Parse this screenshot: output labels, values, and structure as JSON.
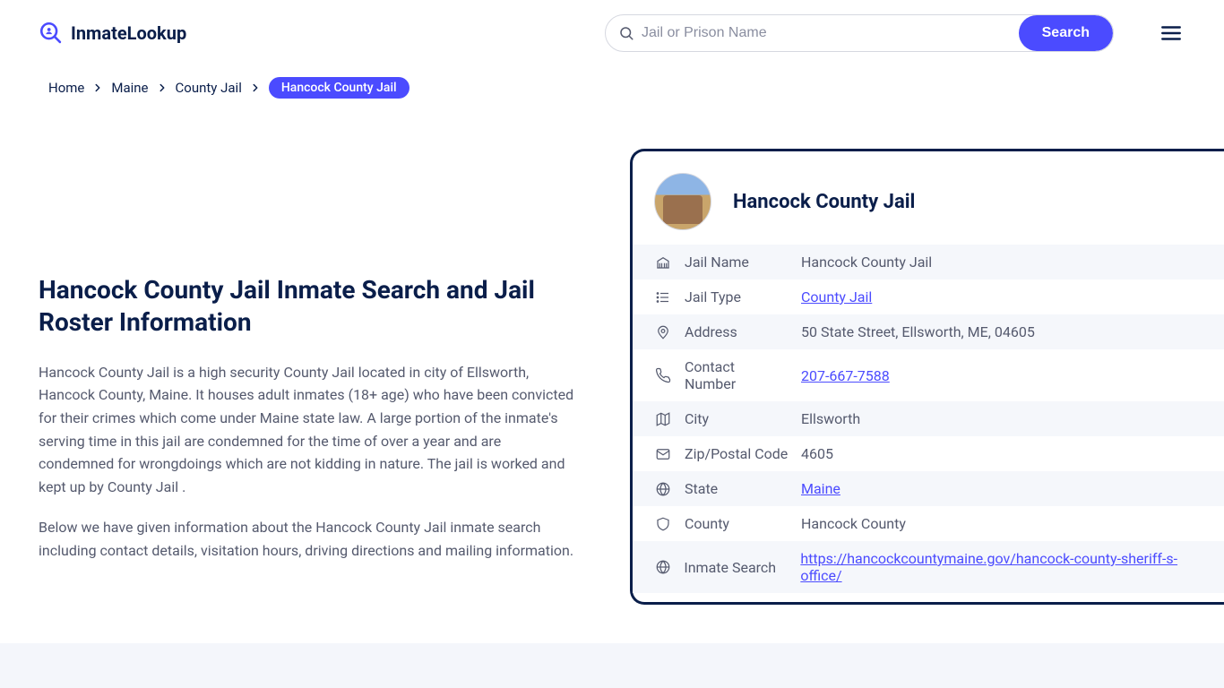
{
  "brand": {
    "name": "InmateLookup"
  },
  "search": {
    "placeholder": "Jail or Prison Name",
    "button": "Search"
  },
  "breadcrumbs": {
    "items": [
      {
        "label": "Home"
      },
      {
        "label": "Maine"
      },
      {
        "label": "County Jail"
      }
    ],
    "current": "Hancock County Jail"
  },
  "article": {
    "title": "Hancock County Jail Inmate Search and Jail Roster Information",
    "p1": "Hancock County Jail is a high security County Jail located in city of Ellsworth, Hancock County, Maine. It houses adult inmates (18+ age) who have been convicted for their crimes which come under Maine state law. A large portion of the inmate's serving time in this jail are condemned for the time of over a year and are condemned for wrongdoings which are not kidding in nature. The jail is worked and kept up by County Jail .",
    "p2": "Below we have given information about the Hancock County Jail inmate search including contact details, visitation hours, driving directions and mailing information."
  },
  "card": {
    "title": "Hancock County Jail",
    "rows": {
      "jail_name": {
        "label": "Jail Name",
        "value": "Hancock County Jail"
      },
      "jail_type": {
        "label": "Jail Type",
        "value": "County Jail",
        "link": true
      },
      "address": {
        "label": "Address",
        "value": "50 State Street, Ellsworth, ME, 04605"
      },
      "contact": {
        "label": "Contact Number",
        "value": "207-667-7588",
        "link": true
      },
      "city": {
        "label": "City",
        "value": "Ellsworth"
      },
      "zip": {
        "label": "Zip/Postal Code",
        "value": "4605"
      },
      "state": {
        "label": "State",
        "value": "Maine",
        "link": true
      },
      "county": {
        "label": "County",
        "value": "Hancock County"
      },
      "inmate_search": {
        "label": "Inmate Search",
        "value": "https://hancockcountymaine.gov/hancock-county-sheriff-s-office/",
        "link": true
      }
    }
  }
}
